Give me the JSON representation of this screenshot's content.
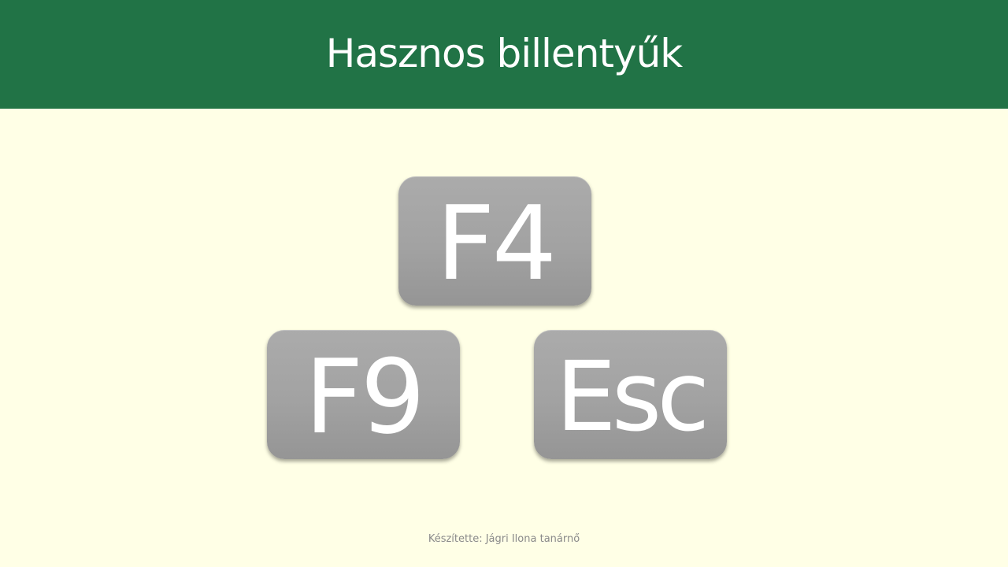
{
  "header": {
    "title": "Hasznos billentyűk",
    "background_color": "#217346",
    "text_color": "#FFFFFF"
  },
  "slide": {
    "background_color": "#FFFFE6"
  },
  "keys": [
    {
      "label": "F4"
    },
    {
      "label": "F9"
    },
    {
      "label": "Esc"
    }
  ],
  "footer": {
    "text": "Készítette: Jágri Ilona tanárnő"
  }
}
